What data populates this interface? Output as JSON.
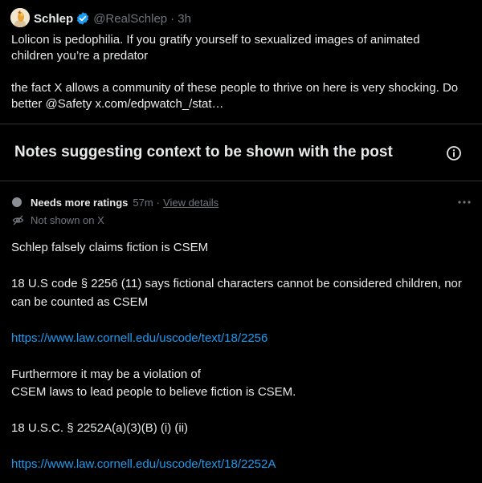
{
  "post": {
    "author": "Schlep",
    "handle": "@RealSchlep",
    "time": "· 3h",
    "text_line1": "Lolicon is pedophilia. If you gratify yourself to sexualized images of animated",
    "text_line2": "children you’re a predator",
    "text_line3": "the fact X allows a community of these people to thrive on here is very shocking. Do",
    "text_line4": "better @Safety x.com/edpwatch_/stat…",
    "icons": [
      "avatar",
      "verified-badge-icon"
    ]
  },
  "notes_section": {
    "title": "Notes suggesting context to be shown with the post",
    "info_icon": "info-icon"
  },
  "note": {
    "rating_status": "Needs more ratings",
    "age": "57m",
    "separator": "·",
    "view_details": "View details",
    "shown_status": "Not shown on X",
    "icons": [
      "status-dot",
      "eye-off-icon",
      "more-icon"
    ],
    "body": {
      "p1": "Schlep falsely claims fiction is CSEM",
      "p2_line1": "18 U.S code § 2256 (11) says fictional characters cannot be considered children, nor",
      "p2_line2": "can be counted as CSEM",
      "link1": "https://www.law.cornell.edu/uscode/text/18/2256",
      "p3_line1": "Furthermore it may be a violation of",
      "p3_line2": "CSEM laws to lead people to believe fiction is CSEM.",
      "p4": "18 U.S.C. § 2252A(a)(3)(B) (i) (ii)",
      "link2": "https://www.law.cornell.edu/uscode/text/18/2252A"
    }
  },
  "colors": {
    "background": "#000000",
    "text": "#e7e9ea",
    "muted": "#71767b",
    "link": "#1d9bf0",
    "verified": "#1d9bf0",
    "divider": "#2f3336"
  }
}
